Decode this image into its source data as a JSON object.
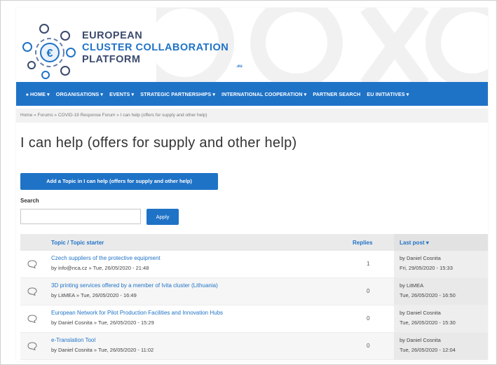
{
  "brand": {
    "line1": "EUROPEAN",
    "line2": "CLUSTER COLLABORATION",
    "line3": "PLATFORM",
    "tld": ".eu",
    "color_primary": "#1f73c7",
    "color_dark": "#3a4a6e"
  },
  "nav": {
    "items": [
      "♠ HOME ▾",
      "ORGANISATIONS ▾",
      "EVENTS ▾",
      "STRATEGIC PARTNERSHIPS ▾",
      "INTERNATIONAL COOPERATION ▾",
      "PARTNER SEARCH",
      "EU INITIATIVES ▾"
    ]
  },
  "breadcrumb": "Home » Forums » COVID-19 Response Forum » I can help (offers for supply and other help)",
  "page_title": "I can help (offers for supply and other help)",
  "add_topic_label": "Add a Topic in I can help (offers for supply and other help)",
  "search": {
    "label": "Search",
    "value": "",
    "apply_label": "Apply"
  },
  "table": {
    "headers": {
      "topic": "Topic / Topic starter",
      "replies": "Replies",
      "last_post": "Last post ▾"
    },
    "rows": [
      {
        "title": "Czech suppliers of the protective equipment",
        "meta": "by info@nca.cz » Tue, 26/05/2020 - 21:48",
        "replies": "1",
        "last_by": "by Daniel Cosnita",
        "last_date": "Fri, 29/05/2020 - 15:33"
      },
      {
        "title": "3D printing services offered by a member of Ivita cluster (Lithuania)",
        "meta": "by LitMEA » Tue, 26/05/2020 - 16:49",
        "replies": "0",
        "last_by": "by LitMEA",
        "last_date": "Tue, 26/05/2020 - 16:50"
      },
      {
        "title": "European Network for Pilot Production Facilities and Innovation Hubs",
        "meta": "by Daniel Cosnita » Tue, 26/05/2020 - 15:29",
        "replies": "0",
        "last_by": "by Daniel Cosnita",
        "last_date": "Tue, 26/05/2020 - 15:30"
      },
      {
        "title": "e-Translation Tool",
        "meta": "by Daniel Cosnita » Tue, 26/05/2020 - 11:02",
        "replies": "0",
        "last_by": "by Daniel Cosnita",
        "last_date": "Tue, 26/05/2020 - 12:04"
      }
    ]
  },
  "icons": {
    "logo": "eccp-logo-icon",
    "topic": "speech-bubble-icon"
  }
}
